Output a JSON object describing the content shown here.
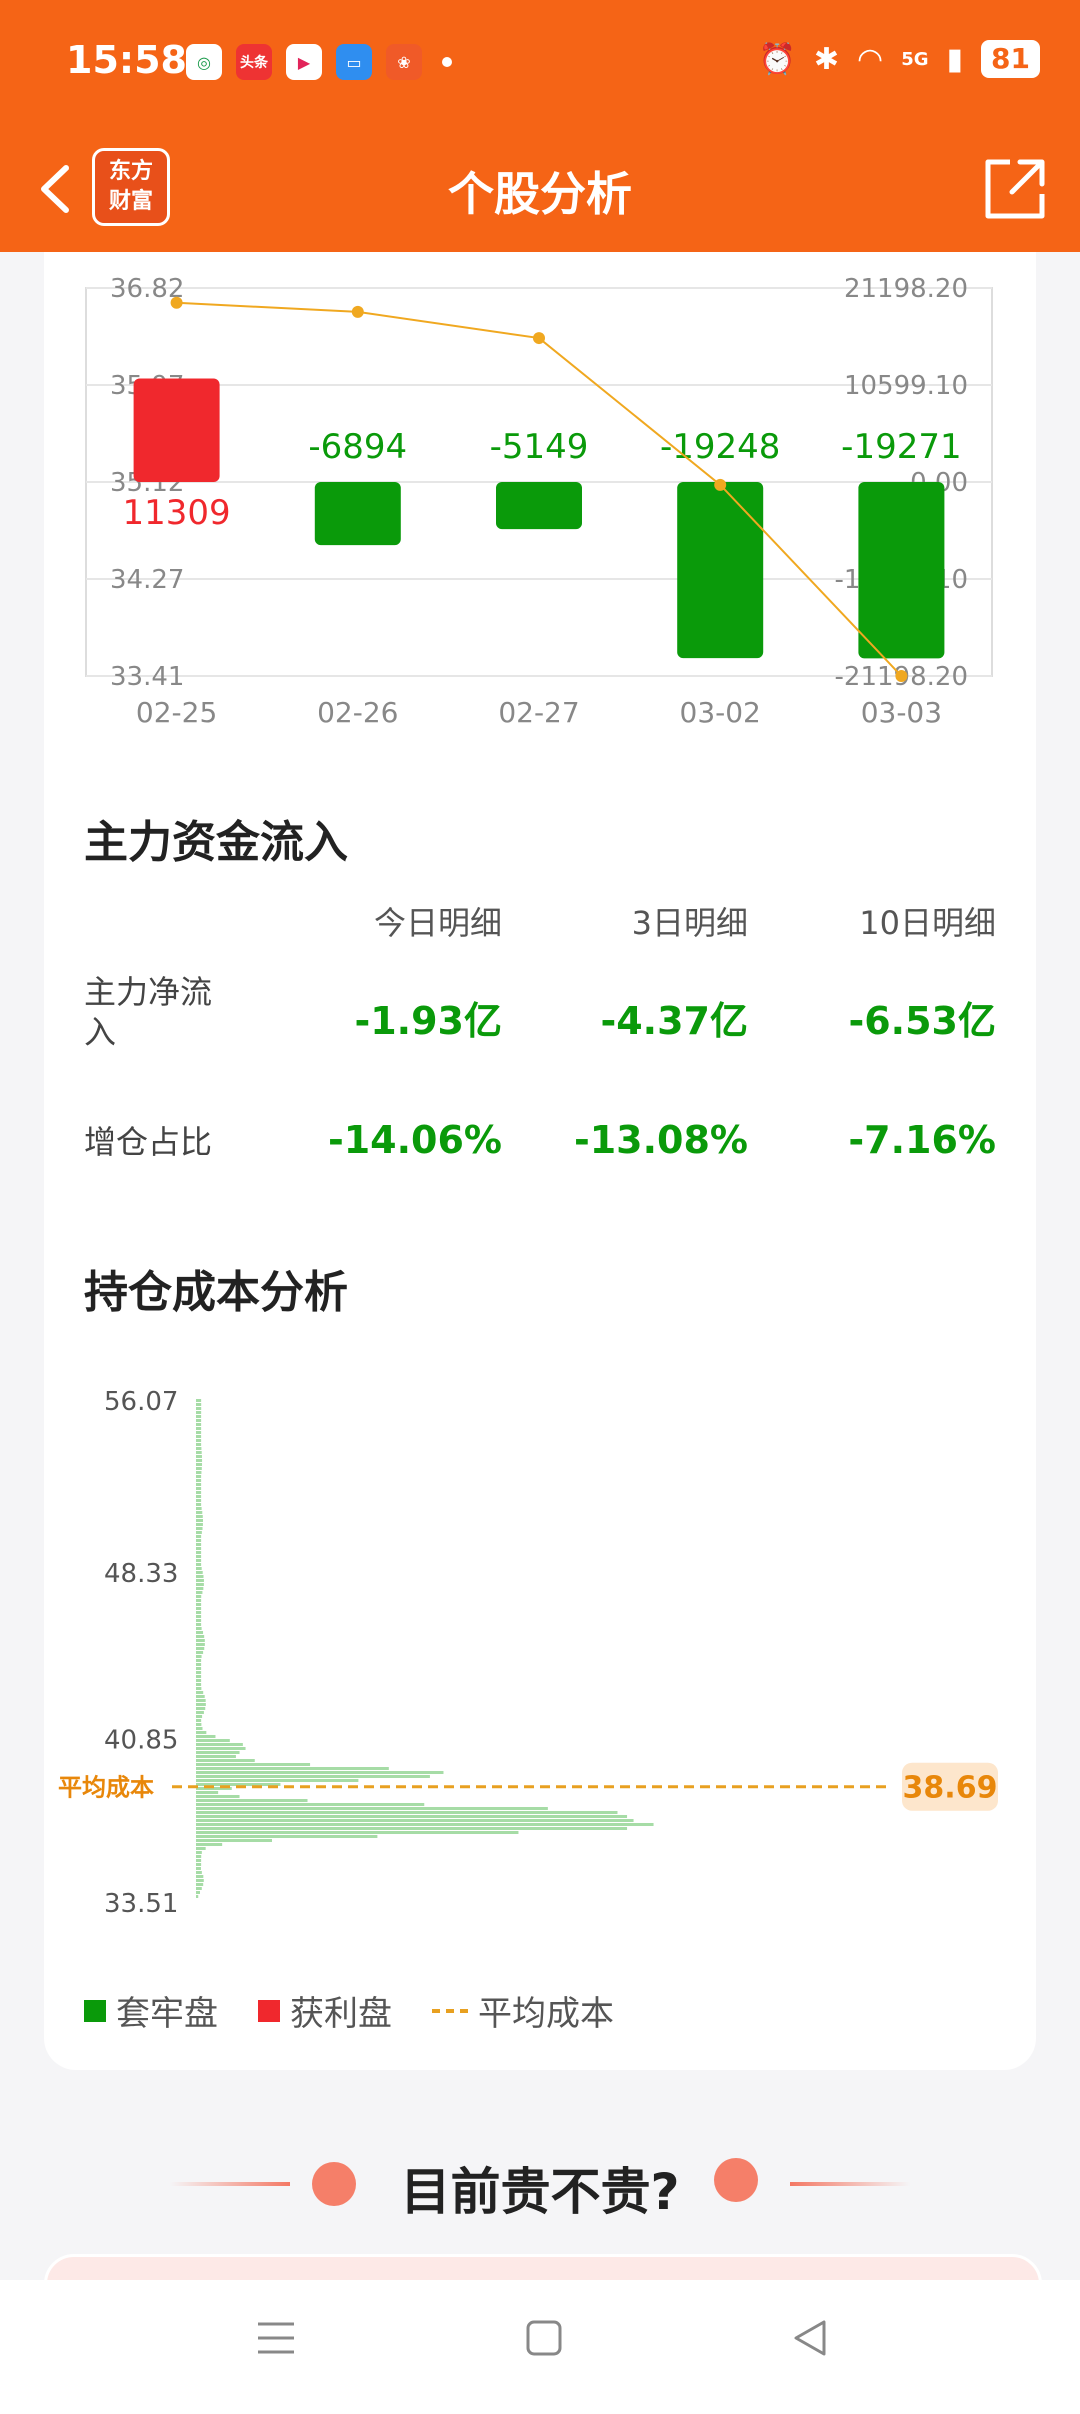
{
  "status_bar": {
    "time": "15:58",
    "apps": [
      "app-icon-1",
      "头条",
      "app-icon-3",
      "app-icon-4",
      "app-icon-5"
    ],
    "network": "5G",
    "battery": "81"
  },
  "nav": {
    "logo_line1": "东方",
    "logo_line2": "财富",
    "title": "个股分析"
  },
  "chart_data": [
    {
      "type": "bar",
      "categories": [
        "02-25",
        "02-26",
        "02-27",
        "03-02",
        "03-03"
      ],
      "values": [
        11309,
        -6894,
        -5149,
        -19248,
        -19271
      ],
      "value_labels": [
        "11309",
        "-6894",
        "-5149",
        "-19248",
        "-19271"
      ],
      "line": {
        "values": [
          36.69,
          36.61,
          36.38,
          35.09,
          33.41
        ],
        "color": "#f0a820"
      },
      "left_ticks": [
        "36.82",
        "35.97",
        "35.12",
        "34.27",
        "33.41"
      ],
      "left_ylim": [
        33.41,
        36.82
      ],
      "right_ticks": [
        "21198.20",
        "10599.10",
        "0.00",
        "-10599.10",
        "-21198.20"
      ],
      "right_ylim": [
        -21198.2,
        21198.2
      ],
      "colors": {
        "positive": "#f0282d",
        "negative": "#0a9a0a"
      },
      "grid": true
    },
    {
      "type": "area",
      "title": "持仓成本分析",
      "y_ticks": [
        "56.07",
        "48.33",
        "40.85",
        "33.51"
      ],
      "ylim": [
        33.51,
        56.07
      ],
      "average_cost": "38.69",
      "average_cost_label": "平均成本",
      "color": "#a6dca6",
      "peaks": [
        {
          "price": 39.2,
          "length": 0.38
        },
        {
          "price": 37.5,
          "length": 0.58
        },
        {
          "price": 36.8,
          "length": 0.63
        },
        {
          "price": 40.4,
          "length": 0.07
        }
      ],
      "legend": [
        "套牢盘",
        "获利盘",
        "平均成本"
      ],
      "legend_colors": [
        "#0a9a0a",
        "#f0282d",
        "#e8a020"
      ]
    }
  ],
  "main_flow": {
    "title": "主力资金流入",
    "headers": [
      "今日明细",
      "3日明细",
      "10日明细"
    ],
    "rows": [
      {
        "label": "主力净流入",
        "values": [
          "-1.93亿",
          "-4.37亿",
          "-6.53亿"
        ]
      },
      {
        "label": "增仓占比",
        "values": [
          "-14.06%",
          "-13.08%",
          "-7.16%"
        ]
      }
    ]
  },
  "promo": {
    "text": "目前贵不贵?"
  }
}
